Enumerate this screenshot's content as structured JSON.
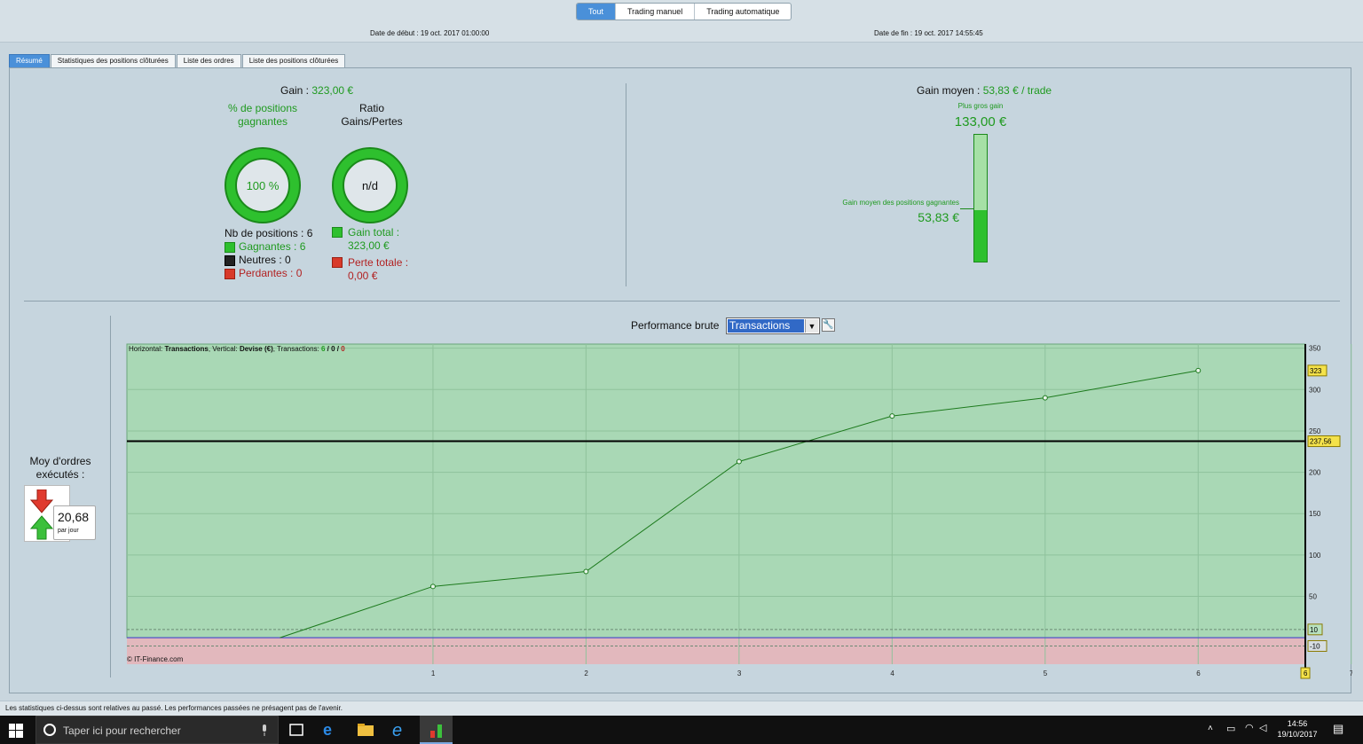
{
  "top": {
    "segments": [
      "Tout",
      "Trading manuel",
      "Trading automatique"
    ],
    "active_segment": "Tout",
    "start_date": "Date de début : 19 oct. 2017 01:00:00",
    "end_date": "Date de fin : 19 oct. 2017 14:55:45"
  },
  "tabs": [
    "Résumé",
    "Statistiques des positions clôturées",
    "Liste des ordres",
    "Liste des positions clôturées"
  ],
  "summary": {
    "gain_label": "Gain : ",
    "gain_value": "323,00 €",
    "pct_label": "% de positions gagnantes",
    "pct_value": "100 %",
    "ratio_label": "Ratio Gains/Pertes",
    "ratio_value": "n/d",
    "nb_positions": "Nb de positions : 6",
    "gagnantes": "Gagnantes : 6",
    "neutres": "Neutres : 0",
    "perdantes": "Perdantes : 0",
    "gain_total_label": "Gain total :",
    "gain_total_value": "323,00 €",
    "perte_totale_label": "Perte totale :",
    "perte_totale_value": "0,00 €",
    "gain_moyen_label": "Gain moyen : ",
    "gain_moyen_value": "53,83 € / trade",
    "plus_gros_gain_label": "Plus gros gain",
    "plus_gros_gain_value": "133,00 €",
    "gain_moyen_gagnantes_label": "Gain moyen des positions gagnantes",
    "gain_moyen_gagnantes_value": "53,83 €",
    "gain_moyen_ratio": 0.405
  },
  "orders": {
    "label": "Moy d'ordres exécutés :",
    "value": "20,68",
    "unit": "par jour"
  },
  "performance": {
    "title": "Performance brute",
    "select_value": "Transactions",
    "info_prefix_h": "Horizontal: ",
    "info_h": "Transactions",
    "info_prefix_v": ", Vertical: ",
    "info_v": "Devise (€)",
    "info_prefix_t": ", Transactions: ",
    "info_t1": "6",
    "info_t2": "0",
    "info_t3": "0",
    "copyright": "© IT-Finance.com"
  },
  "chart_data": {
    "type": "line",
    "x": [
      0,
      1,
      2,
      3,
      4,
      5,
      6
    ],
    "y": [
      0,
      62,
      80,
      213,
      268,
      290,
      323
    ],
    "xlim": [
      -1,
      6.7
    ],
    "ylim": [
      -32,
      355
    ],
    "x_ticks": [
      1,
      2,
      3,
      4,
      5,
      6,
      7
    ],
    "y_ticks": [
      50,
      100,
      150,
      200,
      250,
      300,
      350
    ],
    "cursor_x": 6.7,
    "cursor_x_label": "6",
    "cursor_y": 237.56,
    "cursor_y_label": "237,56",
    "last_value_label": "323",
    "zero_band_label_pos": "10",
    "zero_band_label_neg": "-10",
    "grid": true
  },
  "footer": {
    "disclaimer": "Les statistiques ci-dessus sont relatives au passé. Les performances passées ne présagent pas de l'avenir."
  },
  "taskbar": {
    "search_placeholder": "Taper ici pour rechercher",
    "time": "14:56",
    "date": "19/10/2017"
  }
}
